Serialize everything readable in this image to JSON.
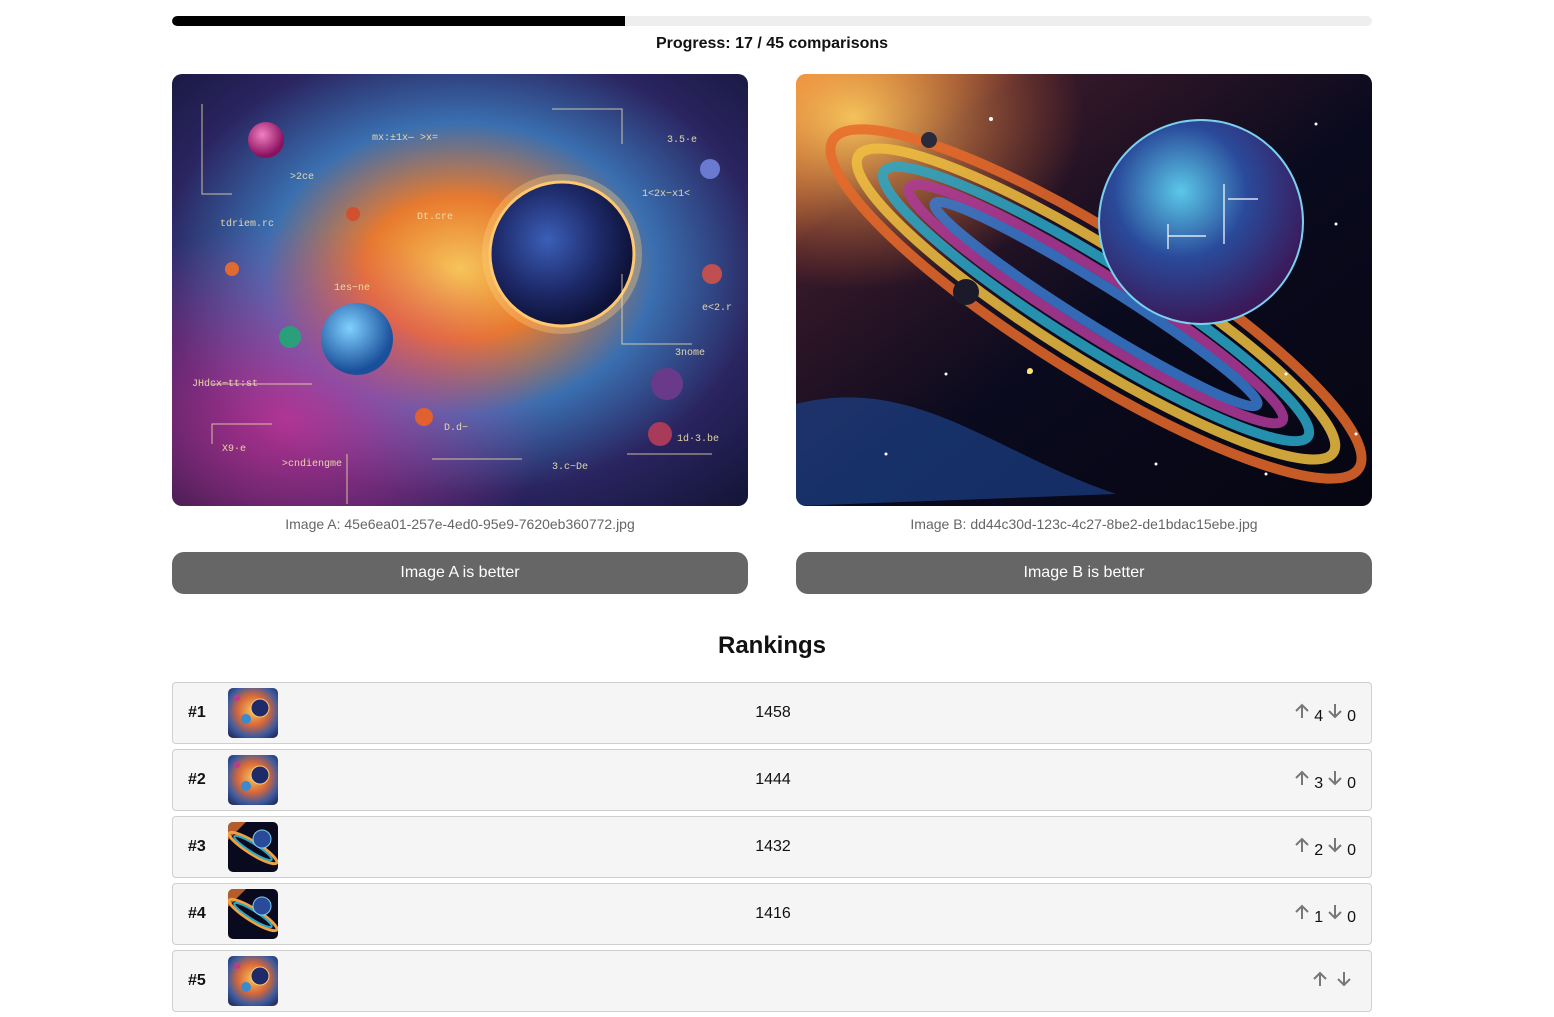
{
  "progress": {
    "label": "Progress: 17 / 45 comparisons",
    "completed": 17,
    "total": 45
  },
  "comparison": {
    "image_a": {
      "caption": "Image A: 45e6ea01-257e-4ed0-95e9-7620eb360772.jpg",
      "button_label": "Image A is better"
    },
    "image_b": {
      "caption": "Image B: dd44c30d-123c-4c27-8be2-de1bdac15ebe.jpg",
      "button_label": "Image B is better"
    }
  },
  "rankings": {
    "title": "Rankings",
    "rows": [
      {
        "rank": "#1",
        "score": "1458",
        "wins": "4",
        "losses": "0"
      },
      {
        "rank": "#2",
        "score": "1444",
        "wins": "3",
        "losses": "0"
      },
      {
        "rank": "#3",
        "score": "1432",
        "wins": "2",
        "losses": "0"
      },
      {
        "rank": "#4",
        "score": "1416",
        "wins": "1",
        "losses": "0"
      },
      {
        "rank": "#5",
        "score": "",
        "wins": "",
        "losses": ""
      }
    ]
  },
  "icons": {
    "upvote": "arrow-up-icon",
    "downvote": "arrow-down-icon"
  },
  "colors": {
    "progress_fill": "#000000",
    "progress_track": "#eeeeee",
    "button_bg": "#666666",
    "row_bg": "#f5f5f5"
  }
}
